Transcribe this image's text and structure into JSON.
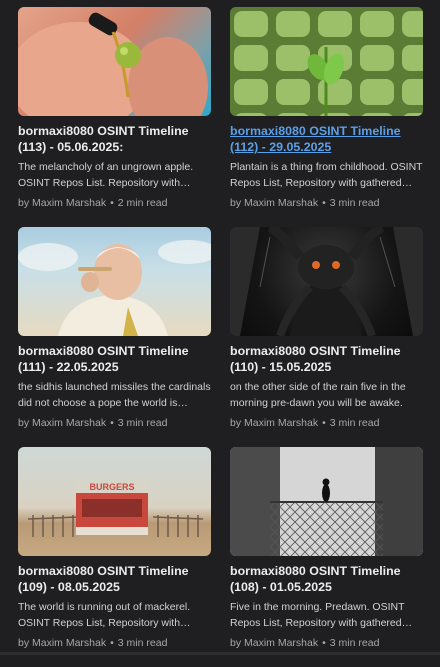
{
  "posts": [
    {
      "title": "bormaxi8080 OSINT Timeline\n(113) - 05.06.2025:",
      "excerpt": "The melancholy of an ungrown apple. OSINT Repos List. Repository with gathered OSINT tools.",
      "author": "by Maxim Marshak",
      "read_time": "2 min read"
    },
    {
      "title": "bormaxi8080 OSINT Timeline\n(112) - 29.05.2025",
      "excerpt": "Plantain is a thing from childhood. OSINT Repos List, Repository with gathered OSINT tools.",
      "author": "by Maxim Marshak",
      "read_time": "3 min read"
    },
    {
      "title": "bormaxi8080 OSINT Timeline\n(111) - 22.05.2025",
      "excerpt": "the sidhis launched missiles the cardinals did not choose a pope the world is waiting.",
      "author": "by Maxim Marshak",
      "read_time": "3 min read"
    },
    {
      "title": "bormaxi8080 OSINT Timeline\n(110) - 15.05.2025",
      "excerpt": "on the other side of the rain five in the morning pre-dawn you will be awake.",
      "author": "by Maxim Marshak",
      "read_time": "3 min read"
    },
    {
      "title": "bormaxi8080 OSINT Timeline\n(109) - 08.05.2025",
      "excerpt": "The world is running out of mackerel. OSINT Repos List, Repository with gathered OSINT tools.",
      "author": "by Maxim Marshak",
      "read_time": "3 min read"
    },
    {
      "title": "bormaxi8080 OSINT Timeline\n(108) - 01.05.2025",
      "excerpt": "Five in the morning. Predawn. OSINT Repos List, Repository with gathered OSINT tools.",
      "author": "by Maxim Marshak",
      "read_time": "3 min read"
    }
  ],
  "thumb_sign_text": "BURGERS"
}
